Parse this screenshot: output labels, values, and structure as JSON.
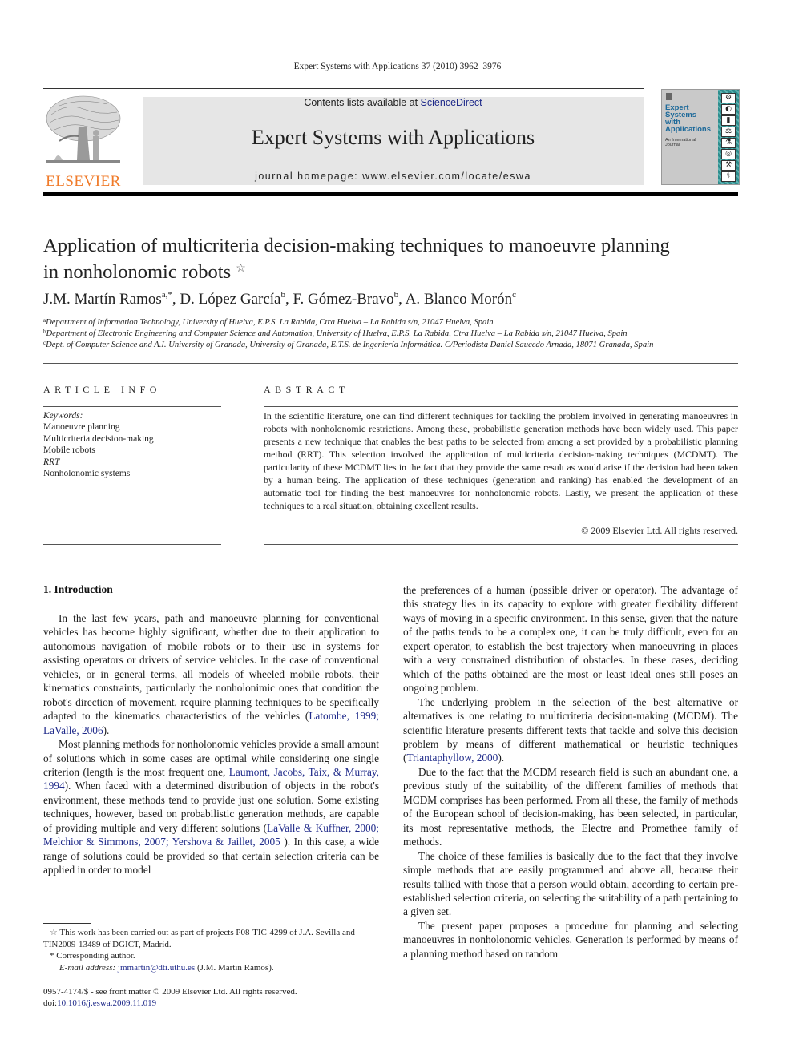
{
  "running_header": "Expert Systems with Applications 37 (2010) 3962–3976",
  "masthead": {
    "publisher_logo_text": "ELSEVIER",
    "contents_prefix": "Contents lists available at ",
    "contents_link": "ScienceDirect",
    "journal_title": "Expert Systems with Applications",
    "homepage": "journal homepage: www.elsevier.com/locate/eswa",
    "cover": {
      "title_lines": [
        "Expert",
        "Systems",
        "with",
        "Applications"
      ],
      "subtitle_lines": [
        "An International",
        "Journal"
      ]
    }
  },
  "article": {
    "title_line1": "Application of multicriteria decision-making techniques to manoeuvre planning",
    "title_line2": "in nonholonomic robots",
    "title_note_mark": "☆",
    "authors": [
      {
        "name": "J.M. Martín Ramos",
        "sup": "a,*",
        "sep": ", "
      },
      {
        "name": "D. López García",
        "sup": "b",
        "sep": ", "
      },
      {
        "name": "F. Gómez-Bravo",
        "sup": "b",
        "sep": ", "
      },
      {
        "name": "A. Blanco Morón",
        "sup": "c",
        "sep": ""
      }
    ],
    "affiliations": [
      {
        "mark": "a",
        "text": "Department of Information Technology, University of Huelva, E.P.S. La Rabida, Ctra Huelva – La Rabida s/n, 21047 Huelva, Spain"
      },
      {
        "mark": "b",
        "text": "Department of Electronic Engineering and Computer Science and Automation, University of Huelva, E.P.S. La Rabida, Ctra Huelva – La Rabida s/n, 21047 Huelva, Spain"
      },
      {
        "mark": "c",
        "text": "Dept. of Computer Science and A.I. University of Granada, University of Granada, E.T.S. de Ingeniería Informática. C/Periodista Daniel Saucedo Arnada, 18071 Granada, Spain"
      }
    ]
  },
  "article_info": {
    "heading": "ARTICLE INFO",
    "keywords_label": "Keywords:",
    "keywords": [
      "Manoeuvre planning",
      "Multicriteria decision-making",
      "Mobile robots",
      "RRT",
      "Nonholonomic systems"
    ]
  },
  "abstract": {
    "heading": "ABSTRACT",
    "text": "In the scientific literature, one can find different techniques for tackling the problem involved in generating manoeuvres in robots with nonholonomic restrictions. Among these, probabilistic generation methods have been widely used. This paper presents a new technique that enables the best paths to be selected from among a set provided by a probabilistic planning method (RRT). This selection involved the application of multicriteria decision-making techniques (MCDMT). The particularity of these MCDMT lies in the fact that they provide the same result as would arise if the decision had been taken by a human being. The application of these techniques (generation and ranking) has enabled the development of an automatic tool for finding the best manoeuvres for nonholonomic robots. Lastly, we present the application of these techniques to a real situation, obtaining excellent results.",
    "copyright": "© 2009 Elsevier Ltd. All rights reserved."
  },
  "body": {
    "section_heading": "1. Introduction",
    "left": {
      "p1_text": "In the last few years, path and manoeuvre planning for conventional vehicles has become highly significant, whether due to their application to autonomous navigation of mobile robots or to their use in systems for assisting operators or drivers of service vehicles. In the case of conventional vehicles, or in general terms, all models of wheeled mobile robots, their kinematics constraints, particularly the nonholonimic ones that condition the robot's direction of movement, require planning techniques to be specifically adapted to the kinematics characteristics of the vehicles (",
      "p1_cite": "Latombe, 1999; LaValle, 2006",
      "p1_end": ").",
      "p2_a": "Most planning methods for nonholonomic vehicles provide a small amount of solutions which in some cases are optimal while considering one single criterion (length is the most frequent one, ",
      "p2_cite1": "Laumont, Jacobs, Taix, & Murray, 1994",
      "p2_b": "). When faced with a determined distribution of objects in the robot's environment, these methods tend to provide just one solution. Some existing techniques, however, based on probabilistic generation methods, are capable of providing multiple and very different solutions (",
      "p2_cite2": "LaValle & Kuffner, 2000; Melchior & Simmons, 2007; Yershova & Jaillet, 2005 ",
      "p2_c": "). In this case, a wide range of solutions could be provided so that certain selection criteria can be applied in order to model"
    },
    "right": {
      "p1": "the preferences of a human (possible driver or operator). The advantage of this strategy lies in its capacity to explore with greater flexibility different ways of moving in a specific environment. In this sense, given that the nature of the paths tends to be a complex one, it can be truly difficult, even for an expert operator, to establish the best trajectory when manoeuvring in places with a very constrained distribution of obstacles. In these cases, deciding which of the paths obtained are the most or least ideal ones still poses an ongoing problem.",
      "p2_text": "The underlying problem in the selection of the best alternative or alternatives is one relating to multicriteria decision-making (MCDM). The scientific literature presents different texts that tackle and solve this decision problem by means of different mathematical or heuristic techniques (",
      "p2_cite": "Triantaphyllow, 2000",
      "p2_end": ").",
      "p3": "Due to the fact that the MCDM research field is such an abundant one, a previous study of the suitability of the different families of methods that MCDM comprises has been performed. From all these, the family of methods of the European school of decision-making, has been selected, in particular, its most representative methods, the Electre and Promethee family of methods.",
      "p4": "The choice of these families is basically due to the fact that they involve simple methods that are easily programmed and above all, because their results tallied with those that a person would obtain, according to certain pre-established selection criteria, on selecting the suitability of a path pertaining to a given set.",
      "p5": "The present paper proposes a procedure for planning and selecting manoeuvres in nonholonomic vehicles. Generation is performed by means of a planning method based on random"
    }
  },
  "footnotes": {
    "note1_mark": "☆",
    "note1": " This work has been carried out as part of projects P08-TIC-4299 of J.A. Sevilla and TIN2009-13489 of DGICT, Madrid.",
    "note2_mark": "*",
    "note2": " Corresponding author.",
    "email_label": "E-mail address: ",
    "email": "jmmartin@dti.uthu.es",
    "email_owner": " (J.M. Martín Ramos)."
  },
  "bottom": {
    "issn_line": "0957-4174/$ - see front matter © 2009 Elsevier Ltd. All rights reserved.",
    "doi_prefix": "doi:",
    "doi": "10.1016/j.eswa.2009.11.019"
  },
  "colors": {
    "link": "#1f2a8a",
    "elsevier_orange": "#f07b2a",
    "banner_bg": "#e6e6e6",
    "cover_teal": "#2e8c8c"
  }
}
